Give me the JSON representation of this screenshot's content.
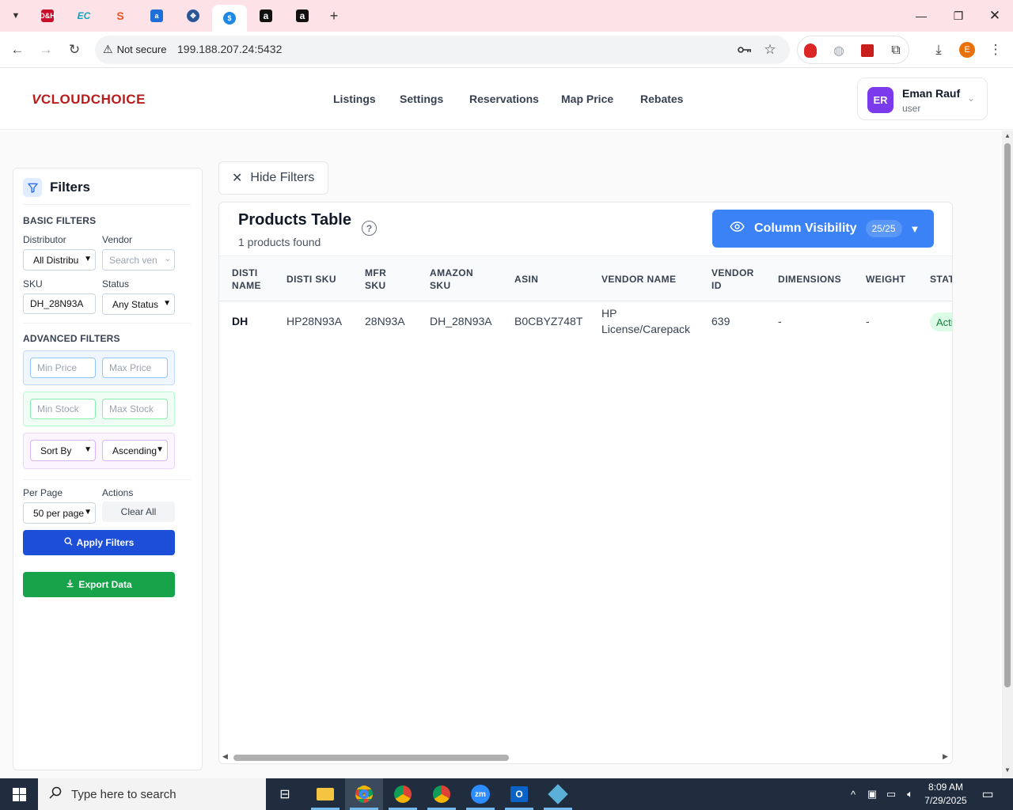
{
  "browser": {
    "tabs": [
      {
        "icon": "dell-icon",
        "color": "#c8102e",
        "text": "D&H"
      },
      {
        "icon": "ec-icon",
        "color": "#0ea5b7",
        "text": "EC"
      },
      {
        "icon": "sync-icon",
        "color": "#e8531f",
        "text": "S"
      },
      {
        "icon": "app-icon",
        "color": "#1e6fd9",
        "text": "a"
      },
      {
        "icon": "network-icon",
        "color": "#2b5797",
        "text": "✥"
      },
      {
        "icon": "dollar-icon",
        "color": "#1e88e5",
        "text": "$"
      },
      {
        "icon": "amazon-icon",
        "color": "#111111",
        "text": "a"
      },
      {
        "icon": "amazon-icon",
        "color": "#111111",
        "text": "a"
      }
    ],
    "not_secure": "Not secure",
    "url": "199.188.207.24:5432",
    "profile_initial": "E"
  },
  "app": {
    "logo": {
      "v": "V",
      "part1": "CLOUD",
      "part2": "CHOICE"
    },
    "nav": [
      "Listings",
      "Settings",
      "Reservations",
      "Map Price",
      "Rebates"
    ],
    "user": {
      "initials": "ER",
      "name": "Eman Rauf",
      "role": "user"
    }
  },
  "filters": {
    "title": "Filters",
    "basic_label": "BASIC FILTERS",
    "distributor_label": "Distributor",
    "distributor_value": "All Distribu",
    "vendor_label": "Vendor",
    "vendor_placeholder": "Search ven",
    "sku_label": "SKU",
    "sku_value": "DH_28N93A",
    "status_label": "Status",
    "status_value": "Any Status",
    "advanced_label": "ADVANCED FILTERS",
    "min_price": "Min Price",
    "max_price": "Max Price",
    "min_stock": "Min Stock",
    "max_stock": "Max Stock",
    "sort_by": "Sort By",
    "order": "Ascending",
    "per_page_label": "Per Page",
    "per_page_value": "50 per page",
    "actions_label": "Actions",
    "clear_all": "Clear All",
    "apply": "Apply Filters",
    "export": "Export Data"
  },
  "main": {
    "hide_filters": "Hide Filters",
    "table_title": "Products Table",
    "count_text": "1 products found",
    "column_visibility": "Column Visibility",
    "column_count": "25/25"
  },
  "table": {
    "headers": [
      {
        "l1": "DISTI",
        "l2": "NAME"
      },
      {
        "l1": "DISTI SKU",
        "l2": ""
      },
      {
        "l1": "MFR",
        "l2": "SKU"
      },
      {
        "l1": "AMAZON",
        "l2": "SKU"
      },
      {
        "l1": "ASIN",
        "l2": ""
      },
      {
        "l1": "VENDOR NAME",
        "l2": ""
      },
      {
        "l1": "VENDOR",
        "l2": "ID"
      },
      {
        "l1": "DIMENSIONS",
        "l2": ""
      },
      {
        "l1": "WEIGHT",
        "l2": ""
      },
      {
        "l1": "STAT",
        "l2": ""
      }
    ],
    "rows": [
      {
        "disti_name": "DH",
        "disti_sku": "HP28N93A",
        "mfr_sku": "28N93A",
        "amazon_sku": "DH_28N93A",
        "asin": "B0CBYZ748T",
        "vendor_name_1": "HP",
        "vendor_name_2": "License/Carepack",
        "vendor_id": "639",
        "dimensions": "-",
        "weight": "-",
        "status": "Acti"
      }
    ]
  },
  "taskbar": {
    "search_placeholder": "Type here to search",
    "time": "8:09 AM",
    "date": "7/29/2025"
  }
}
